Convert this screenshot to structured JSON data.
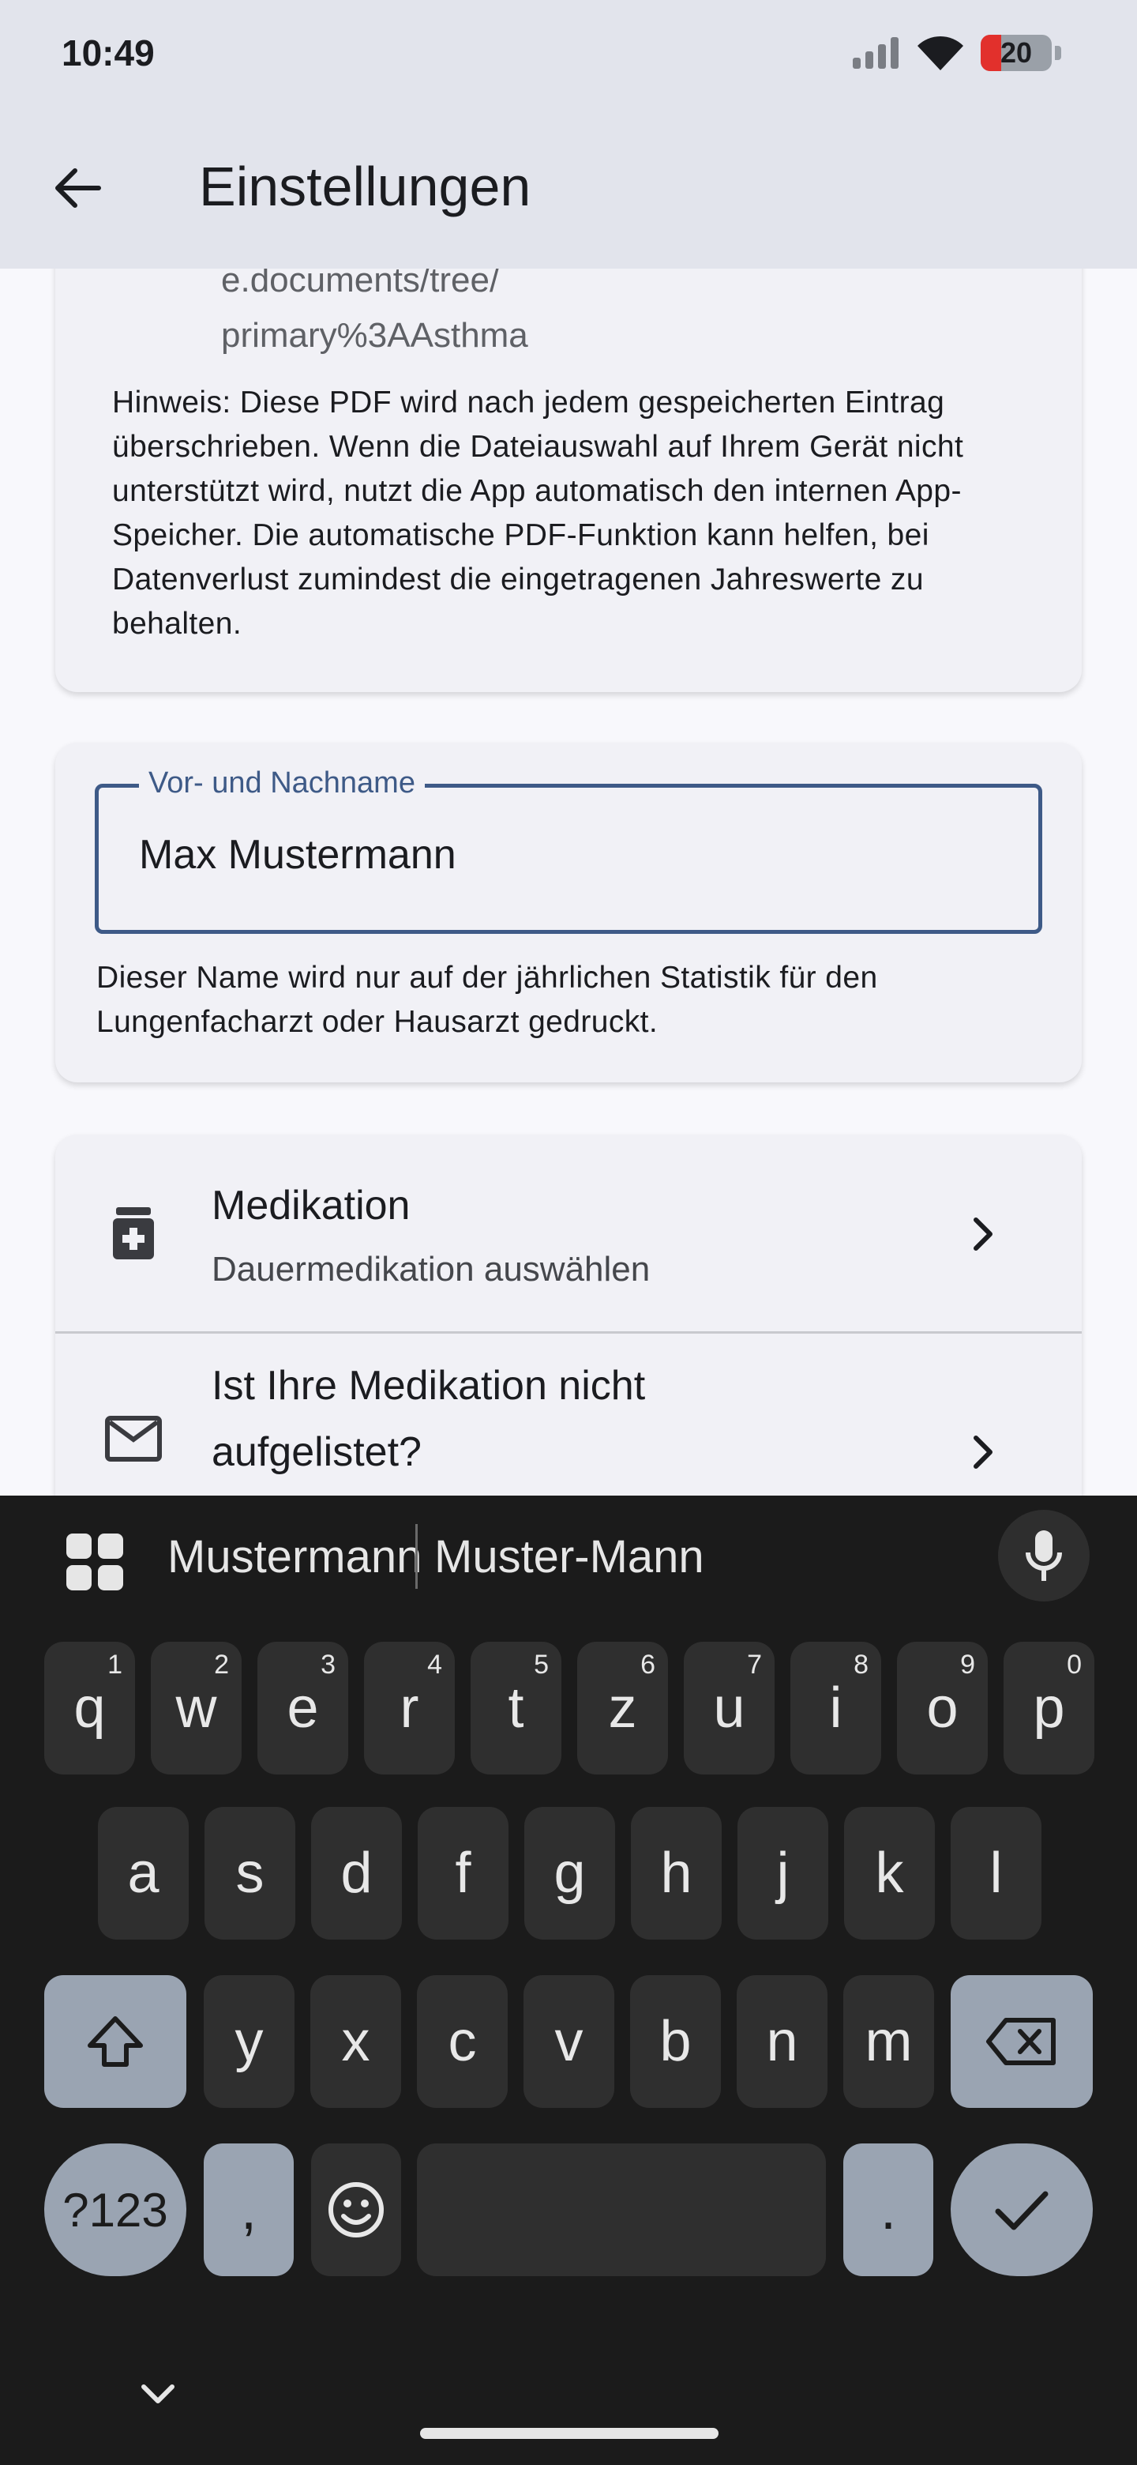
{
  "status_bar": {
    "time": "10:49",
    "battery": "20",
    "icons": [
      "signal-icon",
      "wifi-icon",
      "battery-icon"
    ]
  },
  "app_bar": {
    "title": "Einstellungen",
    "back_icon": "arrow-left-icon"
  },
  "pdf_card": {
    "path_line1": "e.documents/tree/",
    "path_line2": "primary%3AAsthma",
    "hint": "Hinweis: Diese PDF wird nach jedem gespeicherten Eintrag überschrieben. Wenn die Dateiauswahl auf Ihrem Gerät nicht unterstützt wird, nutzt die App automatisch den internen App-Speicher. Die automatische PDF-Funktion kann helfen, bei Datenverlust zumindest die eingetragenen Jahreswerte zu behalten."
  },
  "name_card": {
    "label": "Vor- und Nachname",
    "value": "Max Mustermann",
    "helper": "Dieser Name wird nur auf der jährlichen Statistik für den Lungenfacharzt oder Hausarzt gedruckt."
  },
  "list": {
    "items": [
      {
        "title": "Medikation",
        "subtitle": "Dauermedikation auswählen",
        "icon": "medication-icon"
      },
      {
        "title_line1": "Ist Ihre Medikation nicht",
        "title_line2": "aufgelistet?",
        "icon": "mail-icon"
      }
    ]
  },
  "keyboard": {
    "suggestions": [
      "Mustermann",
      "Muster-Mann"
    ],
    "row1": [
      {
        "k": "q",
        "s": "1"
      },
      {
        "k": "w",
        "s": "2"
      },
      {
        "k": "e",
        "s": "3"
      },
      {
        "k": "r",
        "s": "4"
      },
      {
        "k": "t",
        "s": "5"
      },
      {
        "k": "z",
        "s": "6"
      },
      {
        "k": "u",
        "s": "7"
      },
      {
        "k": "i",
        "s": "8"
      },
      {
        "k": "o",
        "s": "9"
      },
      {
        "k": "p",
        "s": "0"
      }
    ],
    "row2": [
      "a",
      "s",
      "d",
      "f",
      "g",
      "h",
      "j",
      "k",
      "l"
    ],
    "row3": [
      "y",
      "x",
      "c",
      "v",
      "b",
      "n",
      "m"
    ],
    "symbols_key": "?123",
    "comma_key": ",",
    "period_key": "."
  },
  "colors": {
    "accent": "#3e5a87",
    "app_bar_bg": "#e2e4ec",
    "keyboard_bg": "#1b1b1b"
  }
}
